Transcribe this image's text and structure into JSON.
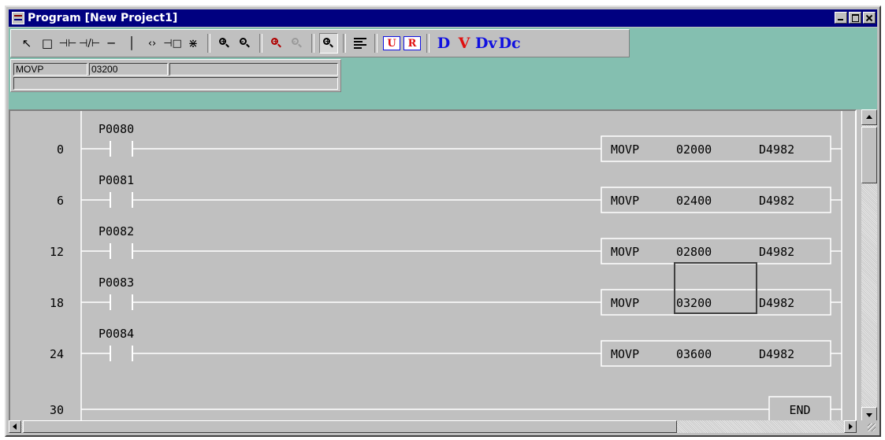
{
  "window": {
    "title": "Program [New Project1]",
    "caption_buttons": [
      "minimize",
      "maximize",
      "close"
    ]
  },
  "toolbar": {
    "tools": [
      {
        "name": "select-tool-icon",
        "glyph": "↖"
      },
      {
        "name": "box-tool-icon",
        "glyph": "□"
      },
      {
        "name": "no-contact-icon",
        "glyph": "⊣⊢"
      },
      {
        "name": "nc-contact-icon",
        "glyph": "⊣/⊢"
      },
      {
        "name": "horizontal-line-icon",
        "glyph": "─"
      },
      {
        "name": "vertical-line-icon",
        "glyph": "│"
      },
      {
        "name": "coil-icon",
        "glyph": "‹›"
      },
      {
        "name": "function-box-icon",
        "glyph": "⊣□"
      },
      {
        "name": "special-icon",
        "glyph": "⋇"
      }
    ],
    "views": [
      "D",
      "V",
      "Dv",
      "Dc"
    ],
    "colors": {
      "blue": "#1010e0",
      "red": "#e01010"
    }
  },
  "command": {
    "instruction": "MOVP",
    "operand1": "03200",
    "operand2": ""
  },
  "ladder": {
    "colors": {
      "background": "#c0c0c0",
      "rung": "#ffffff",
      "text": "#000000",
      "teal": "#84bfb0"
    },
    "rungs": [
      {
        "step": "0",
        "contact": "P0080",
        "instruction": "MOVP",
        "src": "02000",
        "dst": "D4982"
      },
      {
        "step": "6",
        "contact": "P0081",
        "instruction": "MOVP",
        "src": "02400",
        "dst": "D4982"
      },
      {
        "step": "12",
        "contact": "P0082",
        "instruction": "MOVP",
        "src": "02800",
        "dst": "D4982"
      },
      {
        "step": "18",
        "contact": "P0083",
        "instruction": "MOVP",
        "src": "03200",
        "dst": "D4982",
        "selected": true
      },
      {
        "step": "24",
        "contact": "P0084",
        "instruction": "MOVP",
        "src": "03600",
        "dst": "D4982"
      },
      {
        "step": "30",
        "contact": "",
        "instruction": "END",
        "src": "",
        "dst": ""
      }
    ]
  }
}
